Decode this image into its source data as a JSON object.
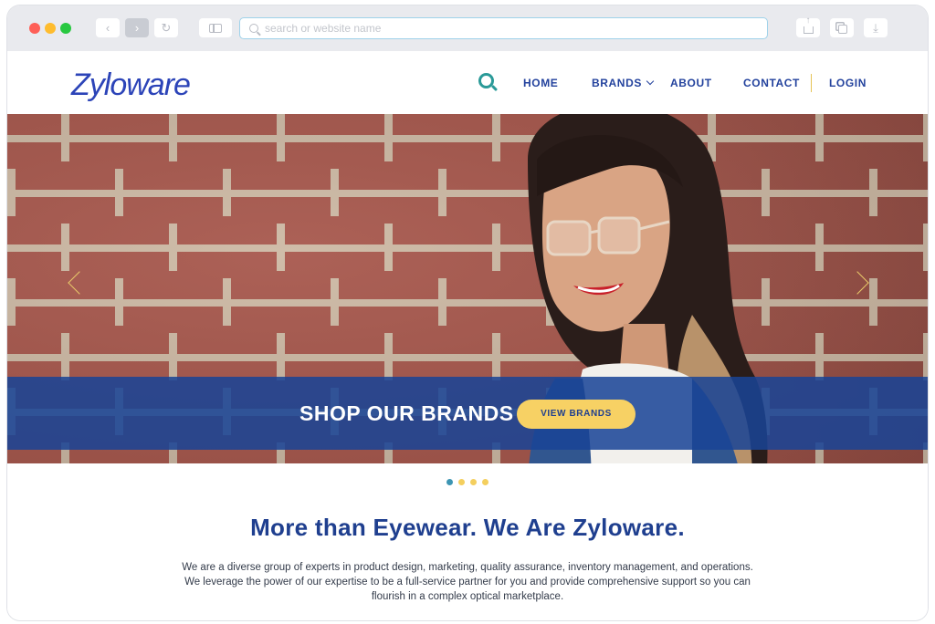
{
  "browser": {
    "address_placeholder": "search or website name"
  },
  "site": {
    "logo": "Zyloware",
    "nav": {
      "home": "HOME",
      "brands": "BRANDS",
      "about": "ABOUT",
      "contact": "CONTACT",
      "login": "LOGIN"
    }
  },
  "hero": {
    "banner_title": "SHOP OUR BRANDS",
    "banner_button": "VIEW BRANDS",
    "slides": 4,
    "active_slide": 1
  },
  "intro": {
    "title": "More than Eyewear. We Are Zyloware.",
    "body": "We are a diverse group of experts in product design, marketing, quality assurance, inventory management, and operations. We leverage the power of our expertise to be a full-service partner for you and provide comprehensive support so you can flourish in a complex optical marketplace."
  },
  "colors": {
    "brand_blue": "#23429d",
    "accent_yellow": "#f7d164",
    "search_teal": "#2a9a98"
  },
  "icons": [
    "back-icon",
    "forward-icon",
    "reload-icon",
    "sidebar-icon",
    "search-icon",
    "share-icon",
    "tabs-icon",
    "download-icon",
    "chevron-down-icon",
    "chevron-left-icon",
    "chevron-right-icon"
  ]
}
